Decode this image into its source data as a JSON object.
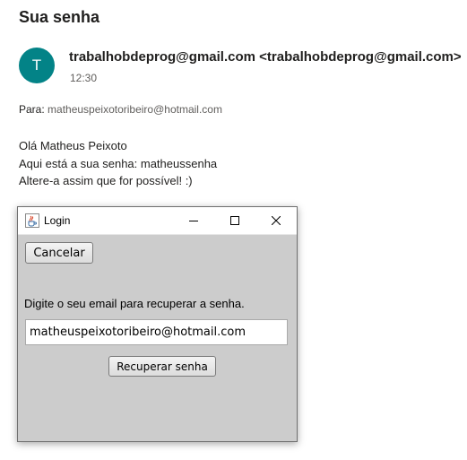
{
  "email": {
    "subject": "Sua senha",
    "avatar_letter": "T",
    "avatar_color": "#038387",
    "sender_name": "trabalhobdeprog@gmail.com",
    "sender_address": "<trabalhobdeprog@gmail.com>",
    "time": "12:30",
    "to_label": "Para:",
    "to_address": "matheuspeixotoribeiro@hotmail.com",
    "body_lines": [
      "Olá Matheus Peixoto",
      "Aqui está a sua senha: matheussenha",
      "Altere-a assim que for possível! :)"
    ]
  },
  "window": {
    "title": "Login",
    "icon": "java-cup-icon",
    "controls": [
      "minimize-icon",
      "maximize-icon",
      "close-icon"
    ],
    "cancel_label": "Cancelar",
    "prompt": "Digite o seu email para recuperar a senha.",
    "email_value": "matheuspeixotoribeiro@hotmail.com",
    "recover_label": "Recuperar senha",
    "background_color": "#cccccc"
  }
}
